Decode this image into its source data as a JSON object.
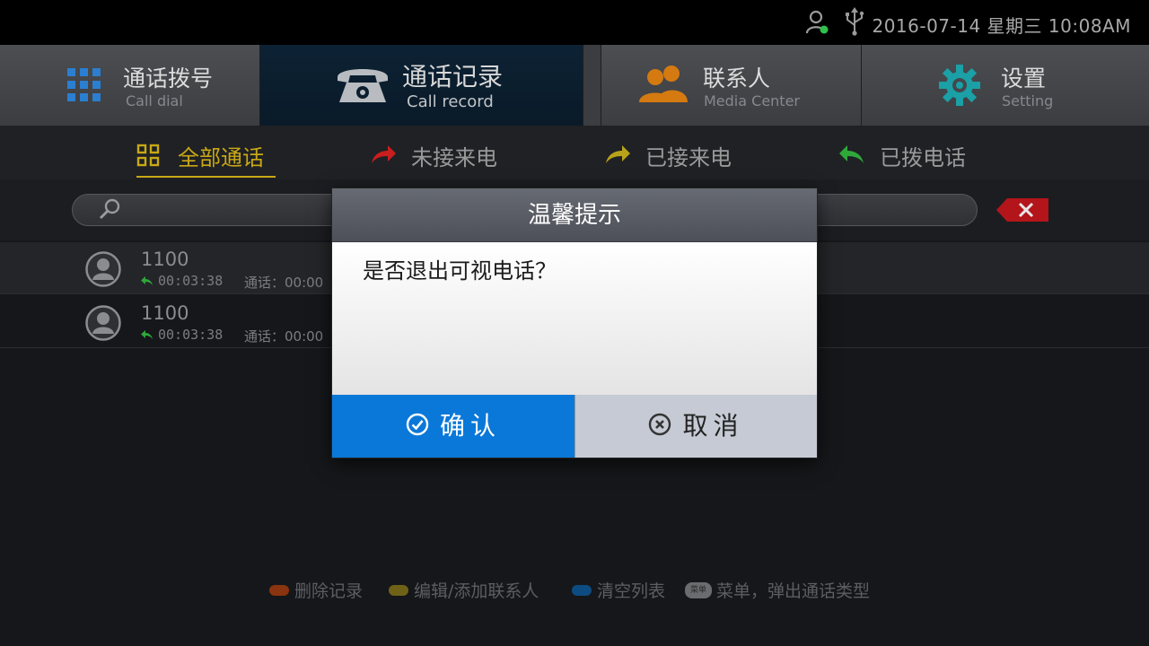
{
  "status": {
    "datetime": "2016-07-14  星期三  10:08AM",
    "icons": [
      "user-status-icon",
      "usb-icon"
    ]
  },
  "main_tabs": [
    {
      "label": "通话拨号",
      "sub": "Call dial",
      "icon": "dialpad-icon",
      "active": false
    },
    {
      "label": "通话记录",
      "sub": "Call record",
      "icon": "telephone-icon",
      "active": true
    },
    {
      "label": "联系人",
      "sub": "Media Center",
      "icon": "contacts-icon",
      "active": false
    },
    {
      "label": "设置",
      "sub": "Setting",
      "icon": "gear-icon",
      "active": false
    }
  ],
  "filter_tabs": [
    {
      "label": "全部通话",
      "icon": "grid-icon",
      "active": true
    },
    {
      "label": "未接来电",
      "icon": "missed-arrow-icon",
      "active": false
    },
    {
      "label": "已接来电",
      "icon": "received-arrow-icon",
      "active": false
    },
    {
      "label": "已拨电话",
      "icon": "dialed-arrow-icon",
      "active": false
    }
  ],
  "search": {
    "placeholder": "",
    "value": ""
  },
  "calls": [
    {
      "number": "1100",
      "time": "00:03:38",
      "duration": "通话：00:00"
    },
    {
      "number": "1100",
      "time": "00:03:38",
      "duration": "通话：00:00"
    }
  ],
  "footer_hints": [
    {
      "label": "删除记录",
      "color": "#c8430e"
    },
    {
      "label": "编辑/添加联系人",
      "color": "#b8a21a"
    },
    {
      "label": "清空列表",
      "color": "#0b72c8"
    },
    {
      "label": "菜单，弹出通话类型",
      "key": "菜单"
    }
  ],
  "dialog": {
    "title": "温馨提示",
    "message": "是否退出可视电话？",
    "confirm_label": "确认",
    "cancel_label": "取消"
  },
  "colors": {
    "accent_blue": "#0a78d8",
    "active_filter": "#c9a814",
    "background": "#15171a"
  }
}
